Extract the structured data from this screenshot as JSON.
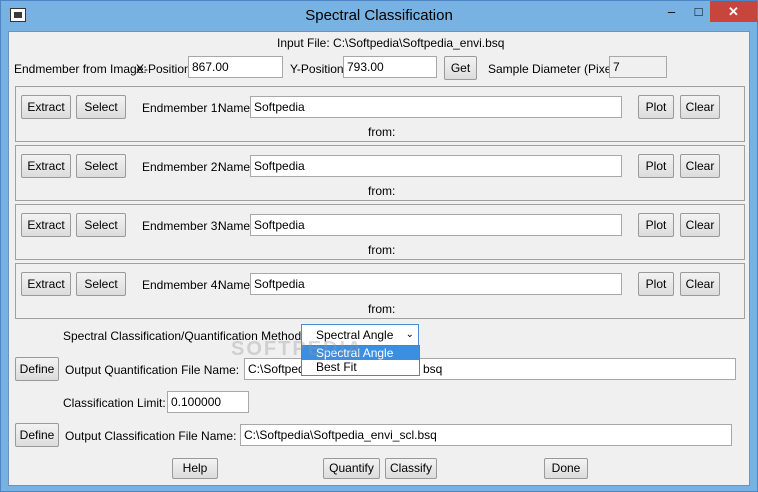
{
  "window": {
    "title": "Spectral Classification",
    "minimize": "–",
    "maximize": "□",
    "close": "✕"
  },
  "input_file_label": "Input File: C:\\Softpedia\\Softpedia_envi.bsq",
  "position_row": {
    "endmember_label": "Endmember from Image:",
    "x_label": "X-Position:",
    "x_value": "867.00",
    "y_label": "Y-Position:",
    "y_value": "793.00",
    "get_label": "Get",
    "diameter_label": "Sample Diameter (Pixels):",
    "diameter_value": "7"
  },
  "endmembers": [
    {
      "extract": "Extract",
      "select": "Select",
      "label": "Endmember 1:",
      "name_label": "Name",
      "name_value": "Softpedia",
      "plot": "Plot",
      "clear": "Clear",
      "from": "from:"
    },
    {
      "extract": "Extract",
      "select": "Select",
      "label": "Endmember 2:",
      "name_label": "Name",
      "name_value": "Softpedia",
      "plot": "Plot",
      "clear": "Clear",
      "from": "from:"
    },
    {
      "extract": "Extract",
      "select": "Select",
      "label": "Endmember 3:",
      "name_label": "Name",
      "name_value": "Softpedia",
      "plot": "Plot",
      "clear": "Clear",
      "from": "from:"
    },
    {
      "extract": "Extract",
      "select": "Select",
      "label": "Endmember 4:",
      "name_label": "Name",
      "name_value": "Softpedia",
      "plot": "Plot",
      "clear": "Clear",
      "from": "from:"
    }
  ],
  "method": {
    "label": "Spectral Classification/Quantification Method:",
    "selected": "Spectral Angle",
    "options": [
      "Spectral Angle",
      "Best Fit"
    ]
  },
  "quant_output": {
    "define": "Define",
    "label": "Output Quantification File Name:",
    "value_start": "C:\\Softpedi",
    "value_end": "bsq"
  },
  "class_limit": {
    "label": "Classification Limit:",
    "value": "0.100000"
  },
  "class_output": {
    "define": "Define",
    "label": "Output Classification File Name:",
    "value": "C:\\Softpedia\\Softpedia_envi_scl.bsq"
  },
  "bottom_buttons": {
    "help": "Help",
    "quantify": "Quantify",
    "classify": "Classify",
    "done": "Done"
  },
  "watermark": "SOFTPEDIA"
}
